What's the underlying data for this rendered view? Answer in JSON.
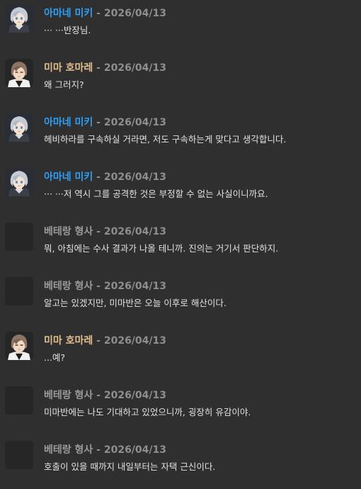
{
  "colors": {
    "amane": "#2f9ff5",
    "mima": "#e0bd8f",
    "berang": "#9a9a9a",
    "date": "#8e8e8e",
    "text": "#e2e2e2",
    "background": "#2f2f2f"
  },
  "separator": "-",
  "messages": [
    {
      "speaker": "amane",
      "name": "아마네 미키",
      "date": "2026/04/13",
      "text": "··· ···반장님.",
      "avatar": "silver-hair-avatar"
    },
    {
      "speaker": "mima",
      "name": "미마 호마레",
      "date": "2026/04/13",
      "text": "왜 그러지?",
      "avatar": "brown-hair-avatar"
    },
    {
      "speaker": "amane",
      "name": "아마네 미키",
      "date": "2026/04/13",
      "text": "헤비하라를 구속하실 거라면, 저도 구속하는게 맞다고 생각합니다.",
      "avatar": "silver-hair-avatar"
    },
    {
      "speaker": "amane",
      "name": "아마네 미키",
      "date": "2026/04/13",
      "text": "··· ···저 역시 그를 공격한 것은 부정할 수 없는 사실이니까요.",
      "avatar": "silver-hair-avatar"
    },
    {
      "speaker": "berang",
      "name": "베테랑 형사",
      "date": "2026/04/13",
      "text": "뭐, 아침에는 수사 결과가 나올 테니까. 진의는 거기서 판단하지.",
      "avatar": "blank-avatar"
    },
    {
      "speaker": "berang",
      "name": "베테랑 형사",
      "date": "2026/04/13",
      "text": "알고는 있겠지만, 미마반은 오늘 이후로 해산이다.",
      "avatar": "blank-avatar"
    },
    {
      "speaker": "mima",
      "name": "미마 호마레",
      "date": "2026/04/13",
      "text": "...예?",
      "avatar": "brown-hair-avatar"
    },
    {
      "speaker": "berang",
      "name": "베테랑 형사",
      "date": "2026/04/13",
      "text": "미마반에는 나도 기대하고 있었으니까, 굉장히 유감이야.",
      "avatar": "blank-avatar"
    },
    {
      "speaker": "berang",
      "name": "베테랑 형사",
      "date": "2026/04/13",
      "text": "호출이 있을 때까지 내일부터는 자택 근신이다.",
      "avatar": "blank-avatar"
    }
  ]
}
